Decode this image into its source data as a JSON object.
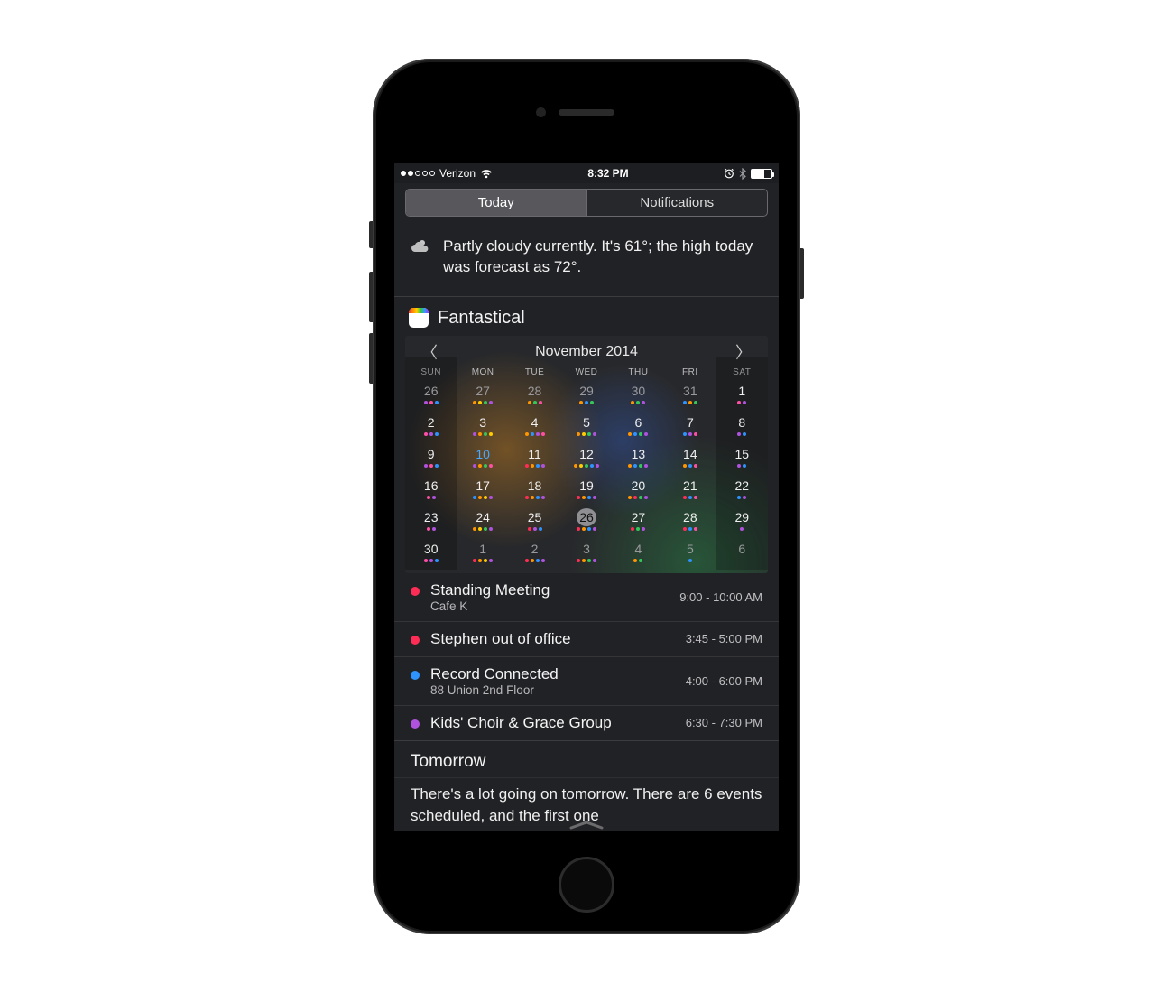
{
  "statusbar": {
    "carrier": "Verizon",
    "time": "8:32 PM",
    "signal_filled": 2,
    "signal_total": 5
  },
  "tabs": {
    "today": "Today",
    "notifications": "Notifications",
    "active": "today"
  },
  "weather": {
    "summary": "Partly cloudy currently. It's 61°; the high today was forecast as 72°."
  },
  "widget": {
    "name": "Fantastical",
    "month_label": "November 2014",
    "dow": [
      "SUN",
      "MON",
      "TUE",
      "WED",
      "THU",
      "FRI",
      "SAT"
    ],
    "days": [
      {
        "n": 26,
        "o": true,
        "d": [
          "purple",
          "pink",
          "blue"
        ]
      },
      {
        "n": 27,
        "o": true,
        "d": [
          "orange",
          "yellow",
          "green",
          "purple"
        ]
      },
      {
        "n": 28,
        "o": true,
        "d": [
          "orange",
          "green",
          "pink"
        ]
      },
      {
        "n": 29,
        "o": true,
        "d": [
          "orange",
          "blue",
          "green"
        ]
      },
      {
        "n": 30,
        "o": true,
        "d": [
          "orange",
          "green",
          "purple"
        ]
      },
      {
        "n": 31,
        "o": true,
        "d": [
          "blue",
          "orange",
          "green"
        ]
      },
      {
        "n": 1,
        "d": [
          "pink",
          "purple"
        ]
      },
      {
        "n": 2,
        "d": [
          "pink",
          "purple",
          "blue"
        ]
      },
      {
        "n": 3,
        "d": [
          "purple",
          "orange",
          "green",
          "yellow"
        ]
      },
      {
        "n": 4,
        "d": [
          "orange",
          "blue",
          "purple",
          "pink"
        ]
      },
      {
        "n": 5,
        "d": [
          "orange",
          "yellow",
          "green",
          "purple"
        ]
      },
      {
        "n": 6,
        "d": [
          "orange",
          "blue",
          "green",
          "purple"
        ]
      },
      {
        "n": 7,
        "d": [
          "blue",
          "purple",
          "pink"
        ]
      },
      {
        "n": 8,
        "d": [
          "purple",
          "blue"
        ]
      },
      {
        "n": 9,
        "d": [
          "purple",
          "pink",
          "blue"
        ]
      },
      {
        "n": 10,
        "sp": true,
        "d": [
          "purple",
          "orange",
          "green",
          "pink"
        ]
      },
      {
        "n": 11,
        "d": [
          "red",
          "orange",
          "blue",
          "purple"
        ]
      },
      {
        "n": 12,
        "d": [
          "orange",
          "yellow",
          "green",
          "blue",
          "purple"
        ]
      },
      {
        "n": 13,
        "d": [
          "orange",
          "blue",
          "green",
          "purple"
        ]
      },
      {
        "n": 14,
        "d": [
          "orange",
          "blue",
          "pink"
        ]
      },
      {
        "n": 15,
        "d": [
          "purple",
          "blue"
        ]
      },
      {
        "n": 16,
        "d": [
          "pink",
          "purple"
        ]
      },
      {
        "n": 17,
        "d": [
          "blue",
          "orange",
          "yellow",
          "purple"
        ]
      },
      {
        "n": 18,
        "d": [
          "red",
          "orange",
          "blue",
          "purple"
        ]
      },
      {
        "n": 19,
        "d": [
          "red",
          "orange",
          "blue",
          "purple"
        ]
      },
      {
        "n": 20,
        "d": [
          "orange",
          "red",
          "green",
          "purple"
        ]
      },
      {
        "n": 21,
        "d": [
          "red",
          "blue",
          "pink"
        ]
      },
      {
        "n": 22,
        "d": [
          "blue",
          "purple"
        ]
      },
      {
        "n": 23,
        "d": [
          "pink",
          "purple"
        ]
      },
      {
        "n": 24,
        "d": [
          "orange",
          "yellow",
          "green",
          "purple"
        ]
      },
      {
        "n": 25,
        "d": [
          "red",
          "purple",
          "blue"
        ]
      },
      {
        "n": 26,
        "sel": true,
        "d": [
          "red",
          "orange",
          "blue",
          "purple"
        ]
      },
      {
        "n": 27,
        "d": [
          "red",
          "green",
          "purple"
        ]
      },
      {
        "n": 28,
        "d": [
          "red",
          "blue",
          "pink"
        ]
      },
      {
        "n": 29,
        "d": [
          "purple"
        ]
      },
      {
        "n": 30,
        "d": [
          "pink",
          "purple",
          "blue"
        ]
      },
      {
        "n": 1,
        "o": true,
        "d": [
          "red",
          "orange",
          "yellow",
          "purple"
        ]
      },
      {
        "n": 2,
        "o": true,
        "d": [
          "red",
          "orange",
          "blue",
          "purple"
        ]
      },
      {
        "n": 3,
        "o": true,
        "d": [
          "red",
          "orange",
          "green",
          "purple"
        ]
      },
      {
        "n": 4,
        "o": true,
        "d": [
          "orange",
          "green"
        ]
      },
      {
        "n": 5,
        "o": true,
        "d": [
          "blue"
        ]
      },
      {
        "n": 6,
        "o": true,
        "d": []
      }
    ],
    "events": [
      {
        "color": "red",
        "title": "Standing Meeting",
        "loc": "Cafe K",
        "time": "9:00 - 10:00 AM"
      },
      {
        "color": "red",
        "title": "Stephen out of office",
        "loc": "",
        "time": "3:45 - 5:00 PM"
      },
      {
        "color": "blue",
        "title": "Record Connected",
        "loc": "88 Union 2nd Floor",
        "time": "4:00 - 6:00 PM"
      },
      {
        "color": "purple",
        "title": "Kids' Choir & Grace Group",
        "loc": "",
        "time": "6:30 - 7:30 PM"
      }
    ]
  },
  "tomorrow": {
    "heading": "Tomorrow",
    "body": "There's a lot going on tomorrow. There are 6 events scheduled, and the first one"
  },
  "colors": {
    "red": "#ff2d55",
    "orange": "#ff9500",
    "yellow": "#ffcc00",
    "green": "#34c759",
    "blue": "#2e92ff",
    "purple": "#af52de",
    "pink": "#ff4fa3"
  }
}
